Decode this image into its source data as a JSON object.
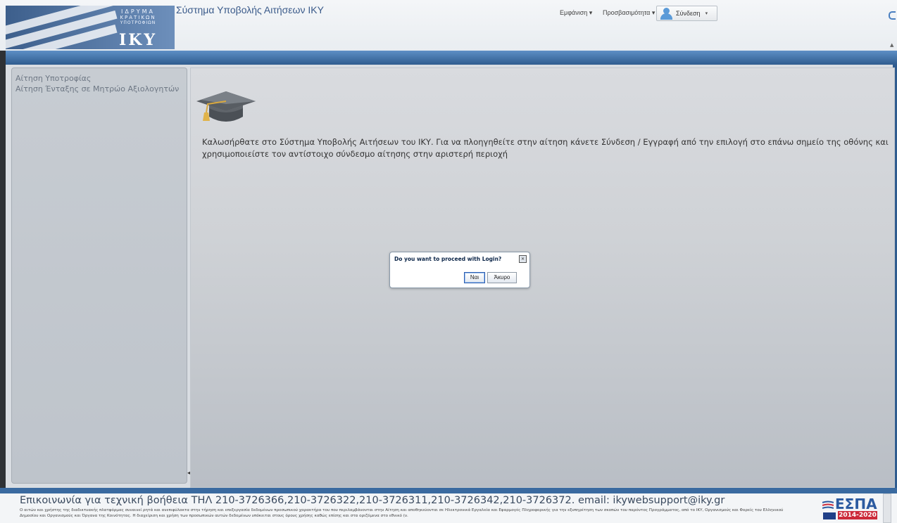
{
  "header": {
    "logo_lines": [
      "ΙΔΡΥΜΑ",
      "ΚΡΑΤΙΚΩΝ",
      "ΥΠΟΤΡΟΦΙΩΝ"
    ],
    "logo_text": "ΙΚΥ",
    "app_title": "Σύστημα Υποβολής Αιτήσεων ΙΚΥ",
    "menu_appearance": "Εμφάνιση ▾",
    "menu_accessibility": "Προσβασιμότητα ▾",
    "login_label": "Σύνδεση",
    "login_caret": "▾"
  },
  "sidebar": {
    "items": [
      {
        "label": "Αίτηση Υποτροφίας"
      },
      {
        "label": "Αίτηση Ένταξης σε Μητρώο Αξιολογητών"
      }
    ]
  },
  "main": {
    "welcome_text": "Καλωσήρθατε στο Σύστημα Υποβολής Αιτήσεων του ΙΚΥ. Για να πλοηγηθείτε στην αίτηση κάνετε Σύνδεση / Εγγραφή από την επιλογή στο επάνω σημείο της οθόνης και χρησιμοποιείστε τον αντίστοιχο σύνδεσμο αίτησης στην αριστερή περιοχή",
    "icon": "graduation-cap-icon"
  },
  "dialog": {
    "message": "Do you want to proceed with Login?",
    "yes_label": "Ναι",
    "cancel_label": "Άκυρο"
  },
  "footer": {
    "contact": "Επικοινωνία για τεχνική βοήθεια ΤΗΛ 210-3726366,210-3726322,210-3726311,210-3726342,210-3726372. email: ikywebsupport@iky.gr",
    "disclaimer": "Ο αιτών και χρήστης της διαδικτυακής πλατφόρμας συναινεί ρητά και ανεπιφύλακτα στην τήρηση και επεξεργασία δεδομένων προσωπικού χαρακτήρα του που περιλαμβάνονται στην Αίτηση και αποθηκεύονται σε Ηλεκτρονικά Εργαλεία και Εφαρμογές Πληροφορικής για την εξυπηρέτηση των σκοπών του παρόντος Προγράμματος, από το ΙΚΥ, Οργανισμούς και Φορείς του Ελληνικού Δημοσίου και Οργανισμούς και Όργανα της Κοινότητας. Η διαχείριση και χρήση των προσωπικών αυτών δεδομένων υπόκειται στους όρους χρήσης καθώς επίσης και στα οριζόμενα στο εθνικό (ν.",
    "espa_title": "ΕΣΠΑ",
    "espa_years": "2014-2020"
  },
  "colors": {
    "header_band": "#2f5c8f",
    "title_blue": "#3a5a8a",
    "espa_red": "#cc2b3b"
  }
}
